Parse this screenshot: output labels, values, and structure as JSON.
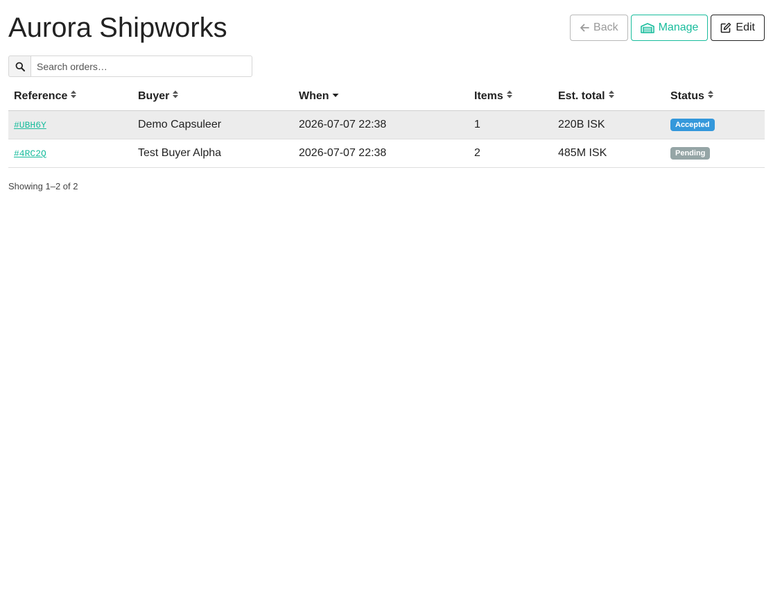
{
  "page": {
    "title": "Aurora Shipworks"
  },
  "toolbar": {
    "back_label": "Back",
    "manage_label": "Manage",
    "edit_label": "Edit"
  },
  "search": {
    "placeholder": "Search orders…",
    "value": ""
  },
  "table": {
    "columns": [
      "Reference",
      "Buyer",
      "When",
      "Items",
      "Est. total",
      "Status"
    ],
    "sorted_column": "When",
    "sort_direction": "desc",
    "rows": [
      {
        "reference": "#UBH6Y",
        "buyer": "Demo Capsuleer",
        "when": "2026-07-07 22:38",
        "items": "1",
        "total": "220B ISK",
        "status": "Accepted"
      },
      {
        "reference": "#4RC2Q",
        "buyer": "Test Buyer Alpha",
        "when": "2026-07-07 22:38",
        "items": "2",
        "total": "485M ISK",
        "status": "Pending"
      }
    ]
  },
  "footer": {
    "showing_text": "Showing 1–2 of 2"
  },
  "colors": {
    "accent": "#18bc9c",
    "accepted": "#3498db",
    "pending": "#95a5a6"
  },
  "icons": {
    "back": "arrow-left-icon",
    "manage": "warehouse-icon",
    "edit": "edit-icon",
    "search": "search-icon",
    "sort": "sort-icon",
    "sort_desc": "sort-down-icon"
  }
}
